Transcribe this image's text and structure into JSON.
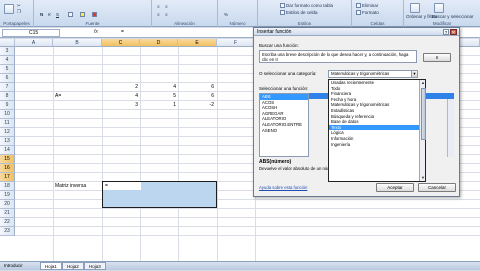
{
  "ribbon": {
    "groups": [
      "Portapapeles",
      "Fuente",
      "Alineación",
      "Número",
      "Estilos",
      "Celdas",
      "Modificar"
    ],
    "items": {
      "format_table": "Dar formato como tabla",
      "cell_styles": "Estilos de celda",
      "delete": "Eliminar",
      "format": "Formato",
      "sort_filter": "Ordenar y filtrar",
      "find_select": "Buscar y seleccionar"
    },
    "format_fmt": "%"
  },
  "formula_bar": {
    "name_box": "C15",
    "fx_label": "fx",
    "content": "="
  },
  "sheet": {
    "columns": [
      "A",
      "B",
      "C",
      "D",
      "E",
      "F",
      "G"
    ],
    "rows": [
      "3",
      "4",
      "5",
      "6",
      "7",
      "8",
      "9",
      "10",
      "11",
      "12",
      "13",
      "14",
      "15",
      "16",
      "17",
      "18",
      "19",
      "20",
      "21",
      "22",
      "23"
    ],
    "matrix_label": "A=",
    "matrix": [
      [
        "2",
        "4",
        "6"
      ],
      [
        "4",
        "5",
        "6"
      ],
      [
        "3",
        "1",
        "-2"
      ]
    ],
    "inverse_label": "Matriz inversa",
    "active_cell_value": "="
  },
  "status": {
    "tabs": [
      "Hoja1",
      "Hoja2",
      "Hoja3"
    ],
    "mode": "Introducir"
  },
  "dialog": {
    "title": "Insertar función",
    "help_icon": "?",
    "search_label": "Buscar una función:",
    "search_text": "Escriba una breve descripción de lo que desea hacer y, a continuación, haga clic en Ir",
    "go_button": "Ir",
    "category_label": "O seleccionar una categoría:",
    "category_value": "Matemáticas y trigonométricas",
    "categories": [
      "Usadas recientemente",
      "Todo",
      "Financiera",
      "Fecha y hora",
      "Matemáticas y trigonométricas",
      "Estadísticas",
      "Búsqueda y referencia",
      "Base de datos",
      "Texto",
      "Lógica",
      "Información",
      "Ingeniería"
    ],
    "category_highlight_index": 8,
    "function_label": "Seleccionar una función:",
    "functions": [
      "ABS",
      "ACOS",
      "ACOSH",
      "AGREGAR",
      "ALEATORIO",
      "ALEATORIO.ENTRE",
      "ASENO"
    ],
    "signature": "ABS(número)",
    "description": "Devuelve el valor absoluto de un número, es decir, un número sin signo.",
    "description_end": "signo.",
    "help_link": "Ayuda sobre esta función",
    "ok_button": "Aceptar",
    "cancel_button": "Cancelar"
  }
}
